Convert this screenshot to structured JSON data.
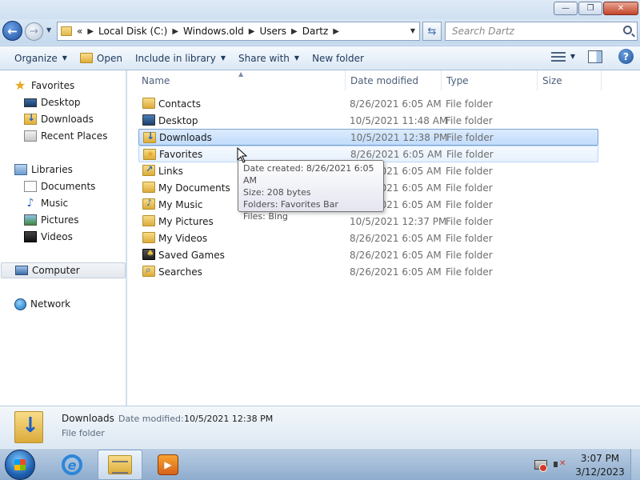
{
  "window": {
    "buttons": {
      "minimize": "—",
      "maximize": "❐",
      "close": "✕"
    }
  },
  "address": {
    "overflow": "«",
    "crumbs": [
      "Local Disk (C:)",
      "Windows.old",
      "Users",
      "Dartz"
    ],
    "search_placeholder": "Search Dartz"
  },
  "toolbar": {
    "organize": "Organize",
    "open": "Open",
    "include": "Include in library",
    "share": "Share with",
    "new_folder": "New folder"
  },
  "nav": {
    "favorites": "Favorites",
    "desktop": "Desktop",
    "downloads": "Downloads",
    "recent": "Recent Places",
    "libraries": "Libraries",
    "documents": "Documents",
    "music": "Music",
    "pictures": "Pictures",
    "videos": "Videos",
    "computer": "Computer",
    "network": "Network"
  },
  "columns": {
    "name": "Name",
    "date": "Date modified",
    "type": "Type",
    "size": "Size"
  },
  "files": [
    {
      "name": "Contacts",
      "date": "8/26/2021 6:05 AM",
      "type": "File folder"
    },
    {
      "name": "Desktop",
      "date": "10/5/2021 11:48 AM",
      "type": "File folder"
    },
    {
      "name": "Downloads",
      "date": "10/5/2021 12:38 PM",
      "type": "File folder"
    },
    {
      "name": "Favorites",
      "date": "8/26/2021 6:05 AM",
      "type": "File folder"
    },
    {
      "name": "Links",
      "date": "8/26/2021 6:05 AM",
      "type": "File folder"
    },
    {
      "name": "My Documents",
      "date": "8/26/2021 6:05 AM",
      "type": "File folder"
    },
    {
      "name": "My Music",
      "date": "8/26/2021 6:05 AM",
      "type": "File folder"
    },
    {
      "name": "My Pictures",
      "date": "10/5/2021 12:37 PM",
      "type": "File folder"
    },
    {
      "name": "My Videos",
      "date": "8/26/2021 6:05 AM",
      "type": "File folder"
    },
    {
      "name": "Saved Games",
      "date": "8/26/2021 6:05 AM",
      "type": "File folder"
    },
    {
      "name": "Searches",
      "date": "8/26/2021 6:05 AM",
      "type": "File folder"
    }
  ],
  "tooltip": {
    "created": "Date created: 8/26/2021 6:05 AM",
    "size": "Size: 208 bytes",
    "folders": "Folders: Favorites Bar",
    "files": "Files: Bing"
  },
  "details": {
    "name": "Downloads",
    "modified_label": "Date modified:",
    "modified_value": "10/5/2021 12:38 PM",
    "type": "File folder"
  },
  "taskbar": {
    "time": "3:07 PM",
    "date": "3/12/2023"
  }
}
